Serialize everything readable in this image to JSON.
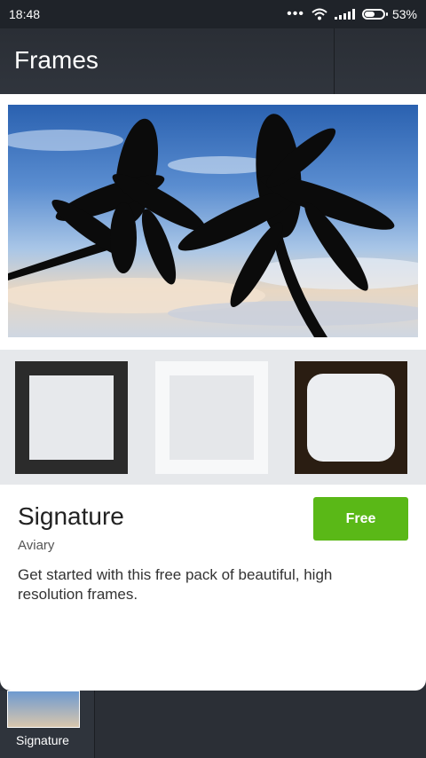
{
  "status": {
    "time": "18:48",
    "battery": "53%",
    "battery_level": 0.53
  },
  "header": {
    "title": "Frames"
  },
  "pack": {
    "name": "Signature",
    "author": "Aviary",
    "description": "Get started with this free pack of beautiful, high resolution frames.",
    "button_label": "Free"
  },
  "tray": {
    "label": "Signature"
  },
  "colors": {
    "accent": "#5ab817",
    "appbar": "#2b2f36"
  },
  "icons": [
    "more-dots-icon",
    "wifi-icon",
    "signal-icon",
    "battery-icon"
  ]
}
